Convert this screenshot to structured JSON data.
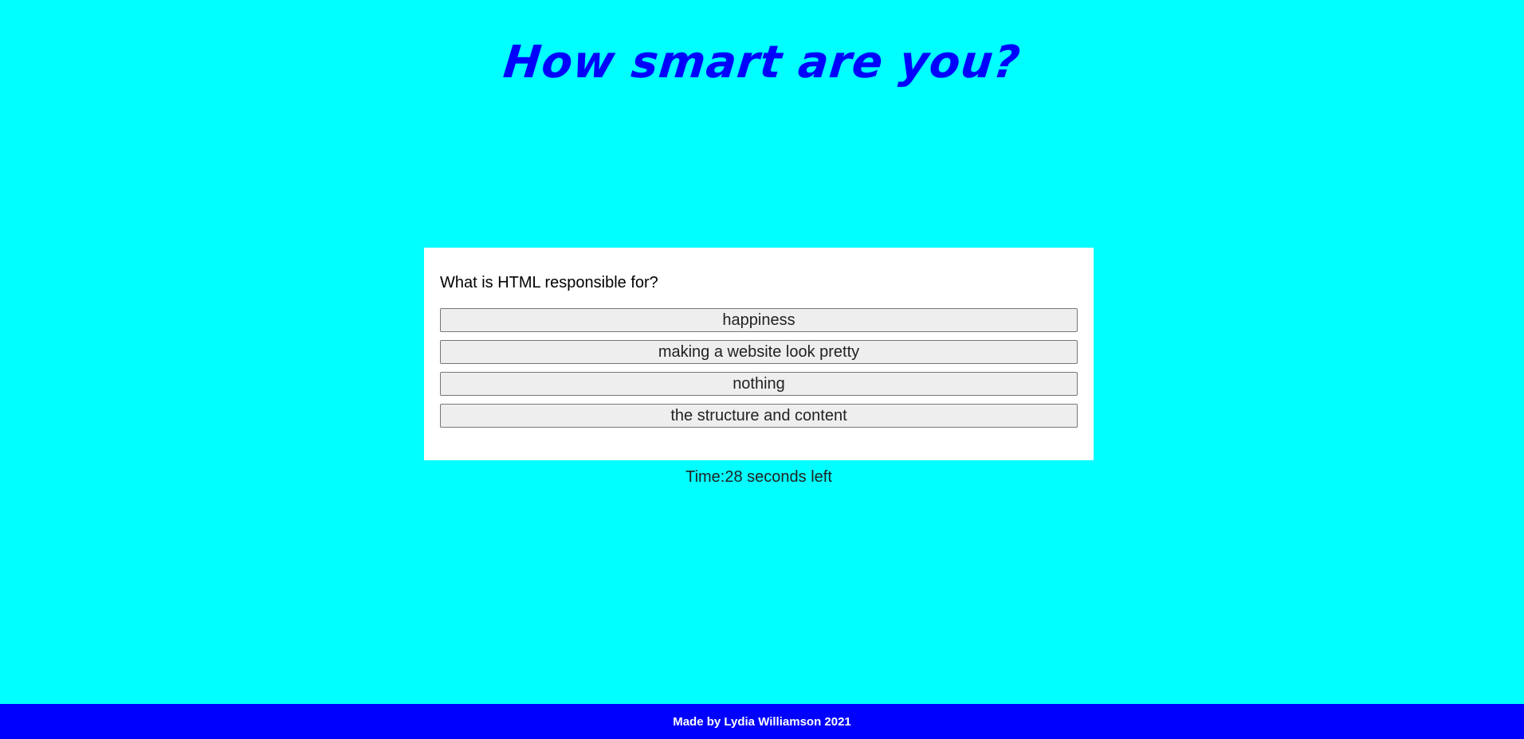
{
  "header": {
    "title": "How smart are you?"
  },
  "quiz": {
    "question": "What is HTML responsible for?",
    "answers": [
      "happiness",
      "making a website look pretty",
      "nothing",
      "the structure and content"
    ]
  },
  "timer": {
    "text": "Time:28 seconds left"
  },
  "footer": {
    "text": "Made by Lydia Williamson 2021"
  },
  "colors": {
    "background": "#00ffff",
    "title": "#0000ff",
    "footer_background": "#0000ff",
    "card_background": "#ffffff",
    "button_background": "#eeeeee"
  }
}
